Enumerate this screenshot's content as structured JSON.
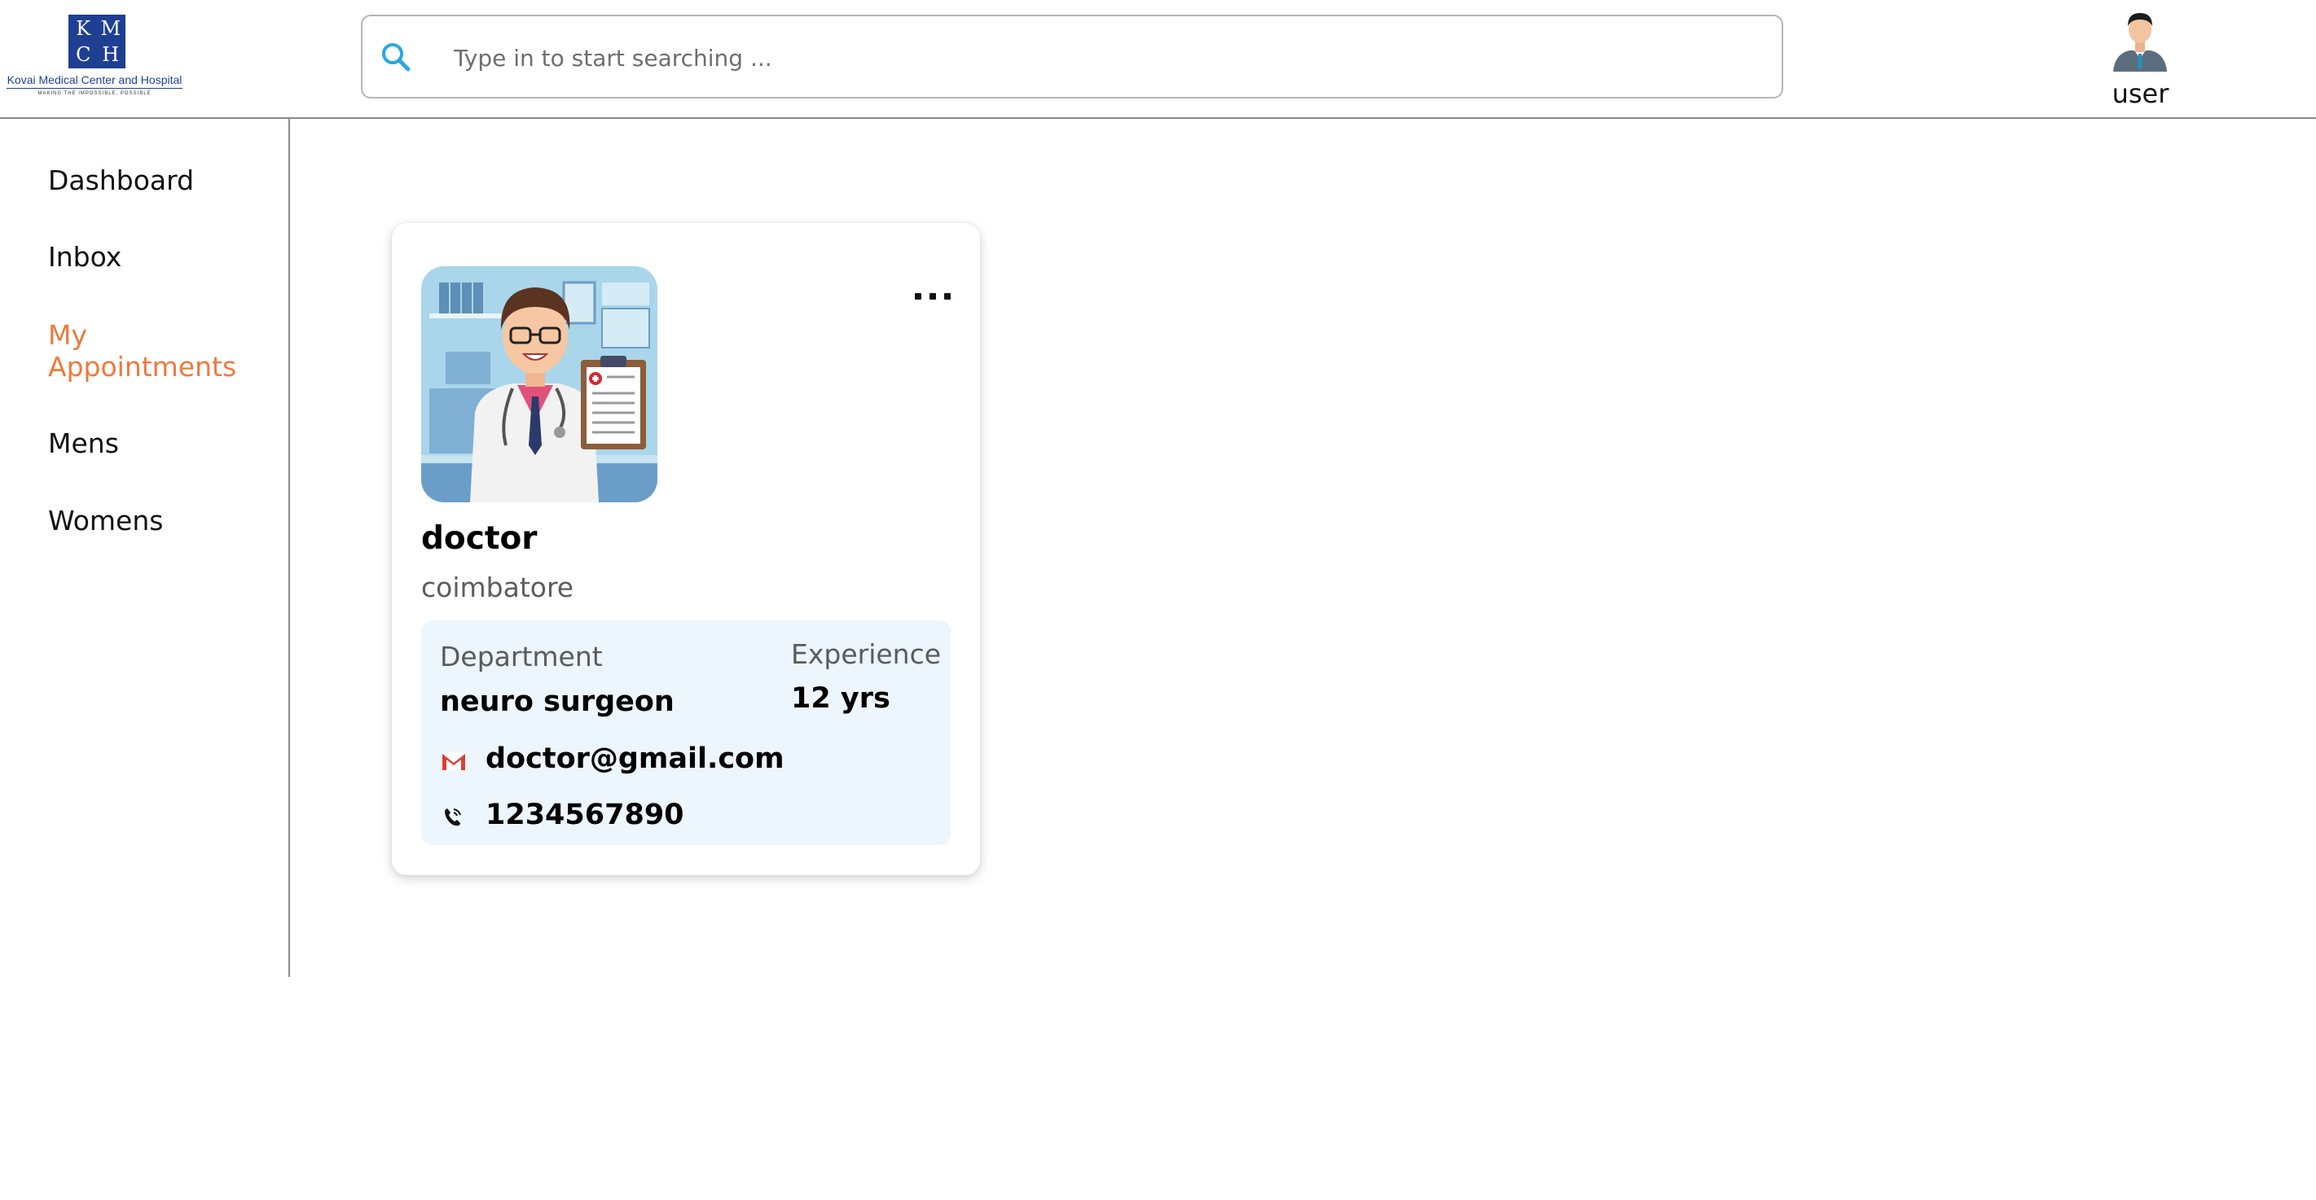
{
  "header": {
    "logo": {
      "letters": [
        "K",
        "M",
        "C",
        "H"
      ],
      "name": "Kovai Medical Center and Hospital",
      "tagline": "MAKING THE IMPOSSIBLE, POSSIBLE"
    },
    "search": {
      "placeholder": "Type in to start searching ...",
      "value": "",
      "icon": "search-icon"
    },
    "user": {
      "label": "user",
      "icon": "user-avatar-icon"
    }
  },
  "sidebar": {
    "items": [
      {
        "label": "Dashboard",
        "active": false
      },
      {
        "label": "Inbox",
        "active": false
      },
      {
        "label": "My Appointments",
        "active": true
      },
      {
        "label": "Mens",
        "active": false
      },
      {
        "label": "Womens",
        "active": false
      }
    ]
  },
  "card": {
    "name": "doctor",
    "location": "coimbatore",
    "department_label": "Department",
    "department": "neuro surgeon",
    "experience_label": "Experience",
    "experience": "12 yrs",
    "email": "doctor@gmail.com",
    "phone": "1234567890",
    "more_icon": "more-options-icon"
  },
  "colors": {
    "accent": "#ee7a3d",
    "search_icon": "#29a8e0",
    "info_bg": "#edf5fd",
    "logo_blue": "#1f3f93"
  }
}
